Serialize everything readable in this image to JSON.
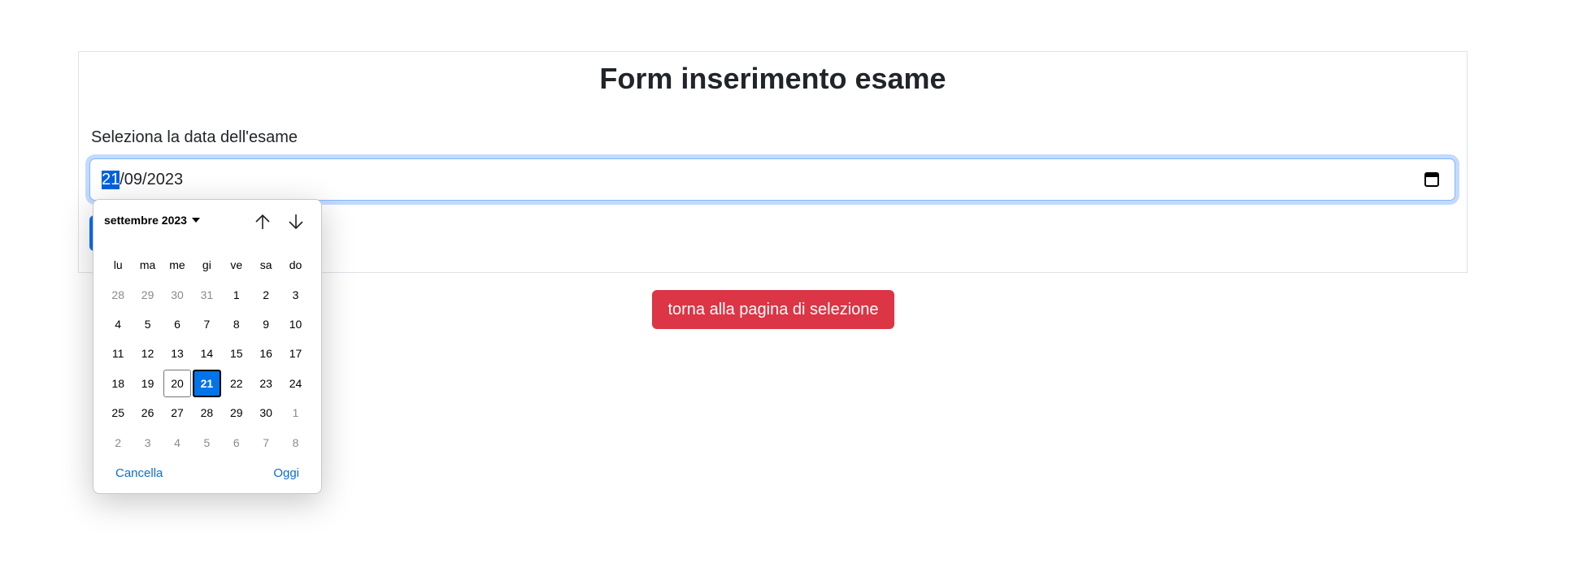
{
  "form": {
    "title": "Form inserimento esame",
    "date_label": "Seleziona la data dell'esame",
    "date_day": "21",
    "date_rest": "/09/2023"
  },
  "back_button": {
    "label": "torna alla pagina di selezione"
  },
  "picker": {
    "month_label": "settembre 2023",
    "weekdays": [
      "lu",
      "ma",
      "me",
      "gi",
      "ve",
      "sa",
      "do"
    ],
    "weeks": [
      [
        {
          "d": "28",
          "o": true
        },
        {
          "d": "29",
          "o": true
        },
        {
          "d": "30",
          "o": true
        },
        {
          "d": "31",
          "o": true
        },
        {
          "d": "1"
        },
        {
          "d": "2"
        },
        {
          "d": "3"
        }
      ],
      [
        {
          "d": "4"
        },
        {
          "d": "5"
        },
        {
          "d": "6"
        },
        {
          "d": "7"
        },
        {
          "d": "8"
        },
        {
          "d": "9"
        },
        {
          "d": "10"
        }
      ],
      [
        {
          "d": "11"
        },
        {
          "d": "12"
        },
        {
          "d": "13"
        },
        {
          "d": "14"
        },
        {
          "d": "15"
        },
        {
          "d": "16"
        },
        {
          "d": "17"
        }
      ],
      [
        {
          "d": "18"
        },
        {
          "d": "19"
        },
        {
          "d": "20",
          "today": true
        },
        {
          "d": "21",
          "sel": true
        },
        {
          "d": "22"
        },
        {
          "d": "23"
        },
        {
          "d": "24"
        }
      ],
      [
        {
          "d": "25"
        },
        {
          "d": "26"
        },
        {
          "d": "27"
        },
        {
          "d": "28"
        },
        {
          "d": "29"
        },
        {
          "d": "30"
        },
        {
          "d": "1",
          "o": true
        }
      ],
      [
        {
          "d": "2",
          "o": true
        },
        {
          "d": "3",
          "o": true
        },
        {
          "d": "4",
          "o": true
        },
        {
          "d": "5",
          "o": true
        },
        {
          "d": "6",
          "o": true
        },
        {
          "d": "7",
          "o": true
        },
        {
          "d": "8",
          "o": true
        }
      ]
    ],
    "cancel_label": "Cancella",
    "today_label": "Oggi"
  },
  "colors": {
    "accent": "#0d6efd",
    "danger": "#dc3545",
    "selected_day": "#0074e8",
    "link": "#0b6dd3"
  },
  "icons": [
    "calendar-icon",
    "arrow-up-icon",
    "arrow-down-icon",
    "caret-down-icon"
  ]
}
